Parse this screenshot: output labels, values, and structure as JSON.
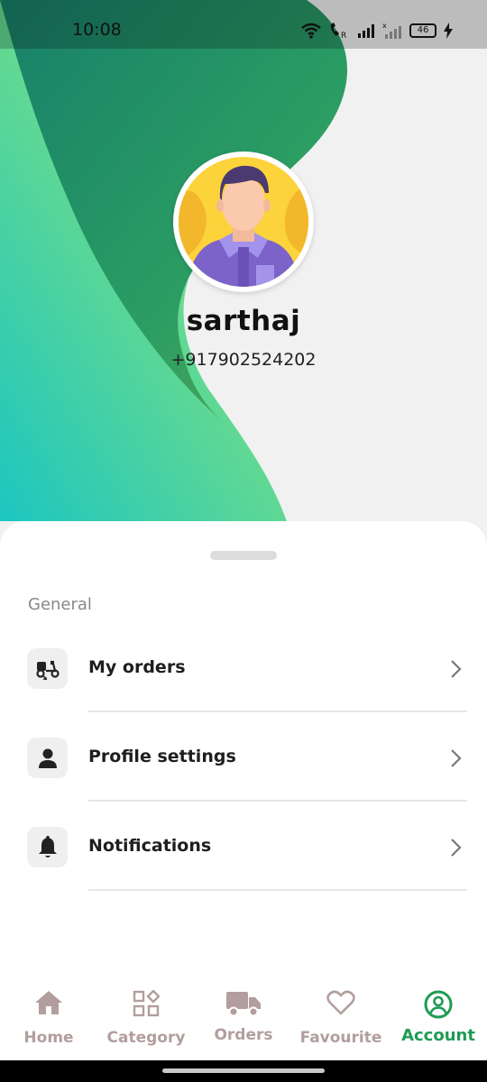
{
  "status_bar": {
    "time": "10:08",
    "battery": "46"
  },
  "profile": {
    "name": "sarthaj",
    "phone": "+917902524202"
  },
  "menu": {
    "section_title": "General",
    "items": [
      {
        "label": "My orders",
        "icon": "delivery-scooter-icon"
      },
      {
        "label": "Profile settings",
        "icon": "person-icon"
      },
      {
        "label": "Notifications",
        "icon": "bell-icon"
      }
    ]
  },
  "bottom_nav": {
    "items": [
      {
        "label": "Home",
        "icon": "home-icon"
      },
      {
        "label": "Category",
        "icon": "category-grid-icon"
      },
      {
        "label": "Orders",
        "icon": "truck-icon"
      },
      {
        "label": "Favourite",
        "icon": "heart-icon"
      },
      {
        "label": "Account",
        "icon": "account-circle-icon"
      }
    ],
    "active": "Account"
  },
  "colors": {
    "accent": "#1f9b55",
    "inactive": "#b29e9e",
    "gradient_teal": "#21c4bb",
    "gradient_green": "#86df7f",
    "gradient_dark": "#1e8d6b"
  }
}
